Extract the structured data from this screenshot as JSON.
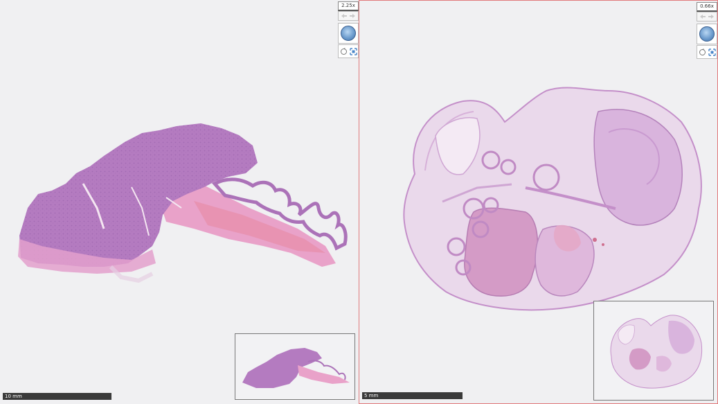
{
  "viewers": [
    {
      "zoom": "2.25x",
      "scale_label": "10 mm"
    },
    {
      "zoom": "0.66x",
      "scale_label": "5 mm"
    }
  ],
  "icons": {
    "nav_back": "arrow-left-icon",
    "nav_forward": "arrow-right-icon",
    "home": "home-globe-icon",
    "rotate": "rotate-icon",
    "fit": "fit-screen-icon"
  },
  "colors": {
    "tissue_purple": "#b47bc0",
    "tissue_pink": "#e79ac4",
    "active_border": "#e0787a",
    "scalebar": "#3a3a3a"
  }
}
